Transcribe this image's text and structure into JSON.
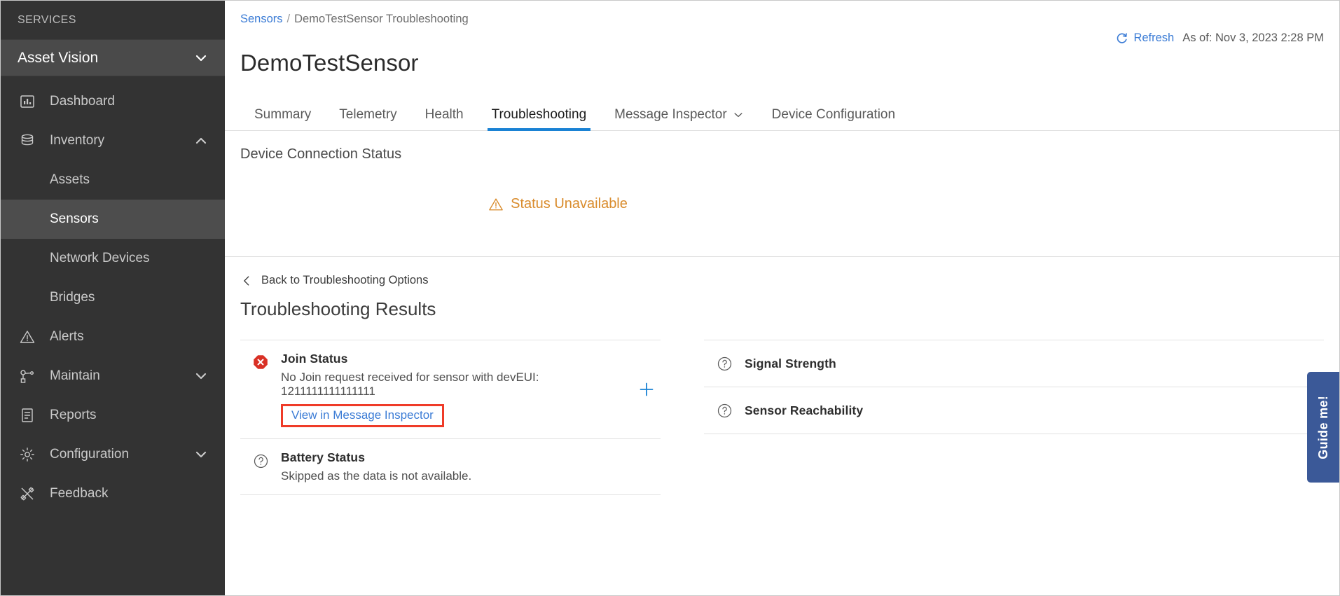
{
  "colors": {
    "sidebar_bg": "#333333",
    "sidebar_active": "#4d4d4d",
    "accent_blue": "#1a82d4",
    "link_blue": "#3a7bd5",
    "warning_orange": "#d98b2b",
    "error_red": "#d93025",
    "highlight_red": "#ef3b28",
    "guide_blue": "#3b5998"
  },
  "sidebar": {
    "services_label": "SERVICES",
    "app_switcher": {
      "label": "Asset Vision",
      "icon": "chevron-down-icon"
    },
    "items": [
      {
        "label": "Dashboard",
        "icon": "dashboard-icon",
        "level": "top",
        "chevron": "",
        "active": false
      },
      {
        "label": "Inventory",
        "icon": "database-icon",
        "level": "top",
        "chevron": "chevron-up-icon",
        "active": false
      },
      {
        "label": "Assets",
        "icon": "",
        "level": "sub",
        "chevron": "",
        "active": false
      },
      {
        "label": "Sensors",
        "icon": "",
        "level": "sub",
        "chevron": "",
        "active": true
      },
      {
        "label": "Network Devices",
        "icon": "",
        "level": "sub",
        "chevron": "",
        "active": false
      },
      {
        "label": "Bridges",
        "icon": "",
        "level": "sub",
        "chevron": "",
        "active": false
      },
      {
        "label": "Alerts",
        "icon": "alert-triangle-icon",
        "level": "top",
        "chevron": "",
        "active": false
      },
      {
        "label": "Maintain",
        "icon": "maintain-icon",
        "level": "top",
        "chevron": "chevron-down-icon",
        "active": false
      },
      {
        "label": "Reports",
        "icon": "report-icon",
        "level": "top",
        "chevron": "",
        "active": false
      },
      {
        "label": "Configuration",
        "icon": "gear-icon",
        "level": "top",
        "chevron": "chevron-down-icon",
        "active": false
      },
      {
        "label": "Feedback",
        "icon": "feedback-icon",
        "level": "top",
        "chevron": "",
        "active": false
      }
    ]
  },
  "breadcrumb": {
    "root": "Sensors",
    "separator": "/",
    "current": "DemoTestSensor Troubleshooting"
  },
  "header": {
    "title": "DemoTestSensor",
    "refresh_label": "Refresh",
    "refresh_icon": "refresh-icon",
    "as_of": "As of: Nov 3, 2023 2:28 PM"
  },
  "tabs": [
    {
      "label": "Summary",
      "active": false,
      "caret": false
    },
    {
      "label": "Telemetry",
      "active": false,
      "caret": false
    },
    {
      "label": "Health",
      "active": false,
      "caret": false
    },
    {
      "label": "Troubleshooting",
      "active": true,
      "caret": false
    },
    {
      "label": "Message Inspector",
      "active": false,
      "caret": true
    },
    {
      "label": "Device Configuration",
      "active": false,
      "caret": false
    }
  ],
  "connection_section": {
    "heading": "Device Connection Status",
    "status_text": "Status Unavailable",
    "status_icon": "warning-triangle-icon"
  },
  "results_section": {
    "back_label": "Back to Troubleshooting Options",
    "back_icon": "chevron-left-icon",
    "heading": "Troubleshooting Results",
    "left_column": [
      {
        "title": "Join Status",
        "icon": "error-octagon-icon",
        "description": "No Join request received for sensor with devEUI: 1211111111111111",
        "link_label": "View in Message Inspector",
        "highlighted": true,
        "expand_icon": "plus-icon"
      },
      {
        "title": "Battery Status",
        "icon": "question-circle-icon",
        "description": "Skipped as the data is not available.",
        "link_label": "",
        "highlighted": false,
        "expand_icon": ""
      }
    ],
    "right_column": [
      {
        "title": "Signal Strength",
        "icon": "question-circle-icon"
      },
      {
        "title": "Sensor Reachability",
        "icon": "question-circle-icon"
      }
    ]
  },
  "guide": {
    "label": "Guide me!"
  }
}
